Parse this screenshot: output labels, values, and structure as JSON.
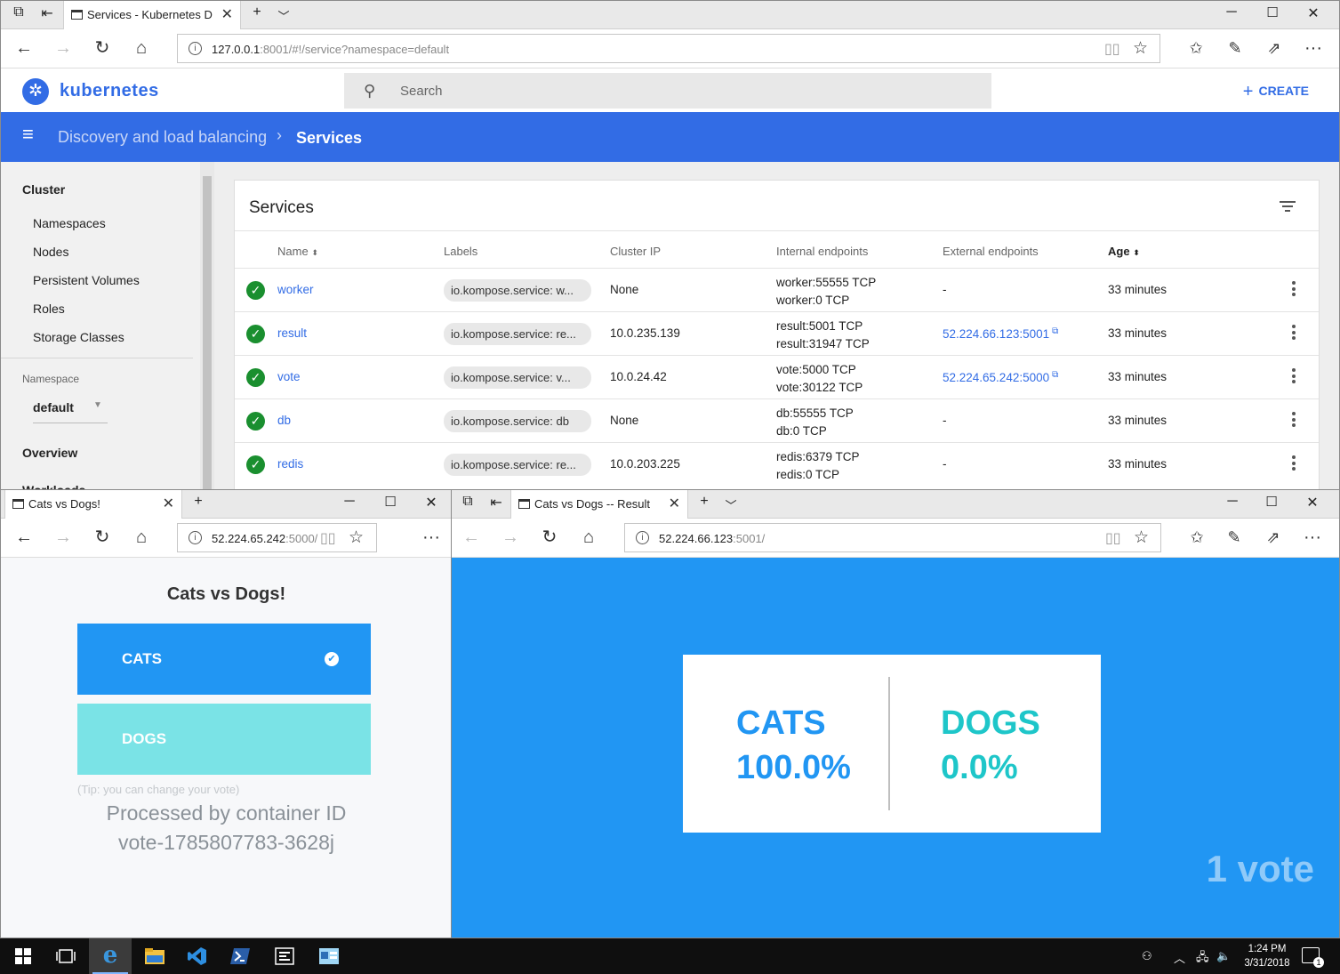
{
  "k8s_window": {
    "tab_title": "Services - Kubernetes D",
    "url_host": "127.0.0.1",
    "url_rest": ":8001/#!/service?namespace=default",
    "brand": "kubernetes",
    "search_placeholder": "Search",
    "create_label": "CREATE",
    "breadcrumb_parent": "Discovery and load balancing",
    "breadcrumb_current": "Services",
    "sidebar": {
      "cluster_heading": "Cluster",
      "cluster_items": [
        "Namespaces",
        "Nodes",
        "Persistent Volumes",
        "Roles",
        "Storage Classes"
      ],
      "namespace_label": "Namespace",
      "namespace_value": "default",
      "overview_label": "Overview",
      "workloads_label": "Workloads"
    },
    "card_title": "Services",
    "columns": [
      "Name",
      "Labels",
      "Cluster IP",
      "Internal endpoints",
      "External endpoints",
      "Age"
    ],
    "rows": [
      {
        "name": "worker",
        "label": "io.kompose.service: w...",
        "ip": "None",
        "ep1": "worker:55555 TCP",
        "ep2": "worker:0 TCP",
        "ext": "-",
        "age": "33 minutes"
      },
      {
        "name": "result",
        "label": "io.kompose.service: re...",
        "ip": "10.0.235.139",
        "ep1": "result:5001 TCP",
        "ep2": "result:31947 TCP",
        "ext": "52.224.66.123:5001",
        "age": "33 minutes"
      },
      {
        "name": "vote",
        "label": "io.kompose.service: v...",
        "ip": "10.0.24.42",
        "ep1": "vote:5000 TCP",
        "ep2": "vote:30122 TCP",
        "ext": "52.224.65.242:5000",
        "age": "33 minutes"
      },
      {
        "name": "db",
        "label": "io.kompose.service: db",
        "ip": "None",
        "ep1": "db:55555 TCP",
        "ep2": "db:0 TCP",
        "ext": "-",
        "age": "33 minutes"
      },
      {
        "name": "redis",
        "label": "io.kompose.service: re...",
        "ip": "10.0.203.225",
        "ep1": "redis:6379 TCP",
        "ep2": "redis:0 TCP",
        "ext": "-",
        "age": "33 minutes"
      }
    ]
  },
  "vote_window": {
    "tab_title": "Cats vs Dogs!",
    "url_host": "52.224.65.242",
    "url_rest": ":5000/",
    "heading": "Cats vs Dogs!",
    "option_a": "CATS",
    "option_b": "DOGS",
    "tip": "(Tip: you can change your vote)",
    "processed_line1": "Processed by container ID",
    "processed_line2": "vote-1785807783-3628j",
    "colors": {
      "cats": "#2196f3",
      "dogs": "#7ae3e6"
    }
  },
  "result_window": {
    "tab_title": "Cats vs Dogs -- Result",
    "url_host": "52.224.66.123",
    "url_rest": ":5001/",
    "cats_label": "CATS",
    "cats_pct": "100.0%",
    "dogs_label": "DOGS",
    "dogs_pct": "0.0%",
    "votes": "1 vote",
    "colors": {
      "background": "#2196f3",
      "cats": "#2196f3",
      "dogs": "#1ec6c9"
    }
  },
  "taskbar": {
    "time": "1:24 PM",
    "date": "3/31/2018",
    "notification_count": "1",
    "icons": [
      "windows-start",
      "task-view",
      "edge",
      "file-explorer",
      "vscode",
      "powershell",
      "terminal",
      "app"
    ]
  }
}
